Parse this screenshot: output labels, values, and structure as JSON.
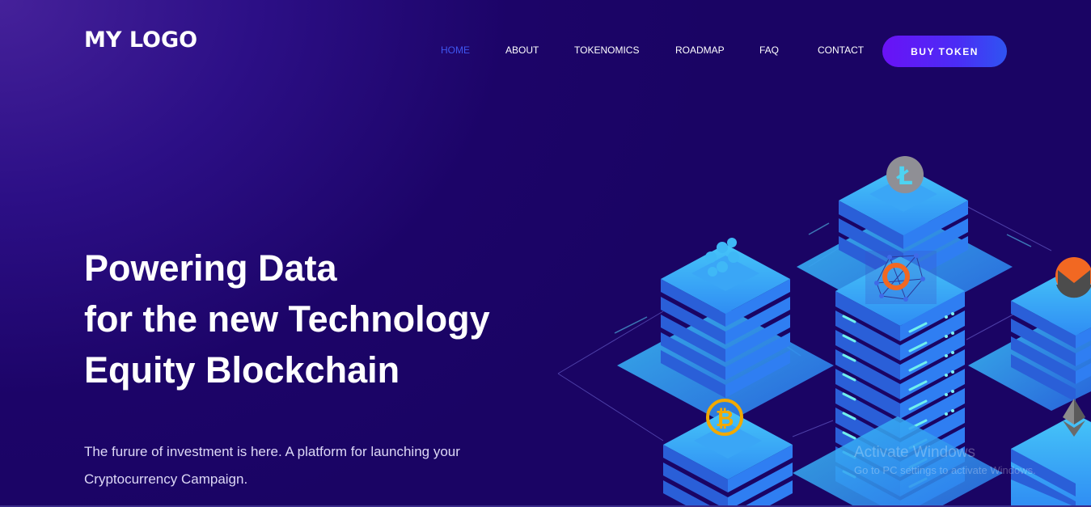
{
  "logo": {
    "text": "MY LOGO"
  },
  "nav": {
    "items": [
      {
        "label": "HOME",
        "active": true
      },
      {
        "label": "ABOUT",
        "active": false
      },
      {
        "label": "TOKENOMICS",
        "active": false
      },
      {
        "label": "ROADMAP",
        "active": false
      },
      {
        "label": "FAQ",
        "active": false
      },
      {
        "label": "CONTACT",
        "active": false
      }
    ],
    "cta_label": "BUY TOKEN"
  },
  "hero": {
    "title_lines": [
      "Powering Data",
      "for the new Technology",
      "Equity Blockchain"
    ],
    "subtitle_line1": "The furure of investment is here. A platform for launching your",
    "subtitle_line2": "Cryptocurrency Campaign."
  },
  "illustration": {
    "coins": [
      "litecoin-icon",
      "ripple-icon",
      "monero-icon",
      "bitcoin-icon",
      "ethereum-icon",
      "network-hub-icon"
    ]
  },
  "watermark": {
    "title": "Activate Windows",
    "subtitle": "Go to PC settings to activate Windows."
  },
  "colors": {
    "background": "#1c0468",
    "nav_active": "#3f56f0",
    "cta_start": "#6a12f6",
    "cta_end": "#2f54f2",
    "server_blue": "#2f8cf4",
    "server_top": "#3fb4f6"
  }
}
